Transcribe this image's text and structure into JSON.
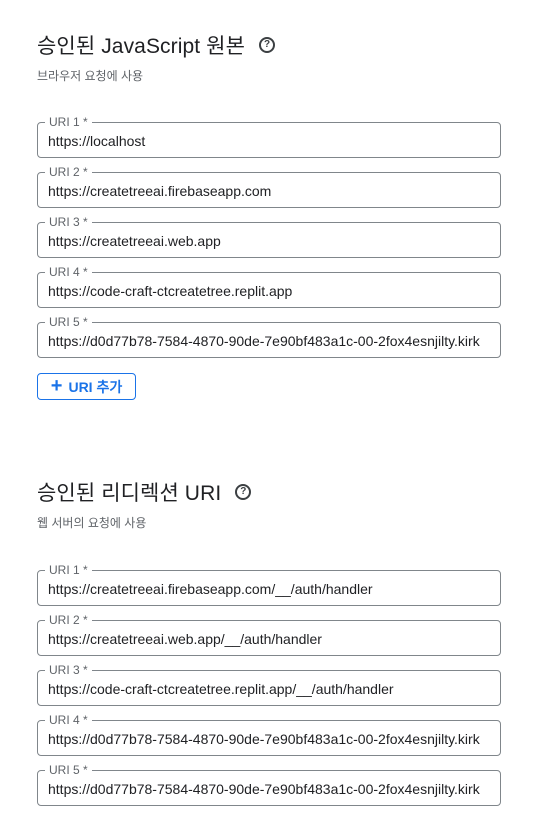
{
  "js_origins": {
    "title": "승인된 JavaScript 원본",
    "subtitle": "브라우저 요청에 사용",
    "fields": [
      {
        "label": "URI 1 *",
        "value": "https://localhost"
      },
      {
        "label": "URI 2 *",
        "value": "https://createtreeai.firebaseapp.com"
      },
      {
        "label": "URI 3 *",
        "value": "https://createtreeai.web.app"
      },
      {
        "label": "URI 4 *",
        "value": "https://code-craft-ctcreatetree.replit.app"
      },
      {
        "label": "URI 5 *",
        "value": "https://d0d77b78-7584-4870-90de-7e90bf483a1c-00-2fox4esnjilty.kirk"
      }
    ],
    "add_button_label": "URI 추가"
  },
  "redirect_uris": {
    "title": "승인된 리디렉션 URI",
    "subtitle": "웹 서버의 요청에 사용",
    "fields": [
      {
        "label": "URI 1 *",
        "value": "https://createtreeai.firebaseapp.com/__/auth/handler"
      },
      {
        "label": "URI 2 *",
        "value": "https://createtreeai.web.app/__/auth/handler"
      },
      {
        "label": "URI 3 *",
        "value": "https://code-craft-ctcreatetree.replit.app/__/auth/handler"
      },
      {
        "label": "URI 4 *",
        "value": "https://d0d77b78-7584-4870-90de-7e90bf483a1c-00-2fox4esnjilty.kirk"
      },
      {
        "label": "URI 5 *",
        "value": "https://d0d77b78-7584-4870-90de-7e90bf483a1c-00-2fox4esnjilty.kirk"
      }
    ]
  },
  "icons": {
    "help": "help-circle-icon",
    "add": "plus-icon",
    "help_glyph": "?",
    "add_glyph": "+"
  },
  "colors": {
    "accent": "#1a73e8",
    "border": "#80868b",
    "text": "#202124",
    "muted": "#5f6368"
  }
}
